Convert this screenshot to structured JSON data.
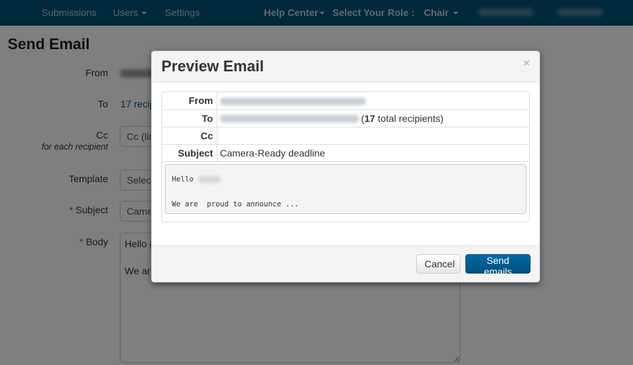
{
  "navbar": {
    "items": [
      {
        "label": "Submissions"
      },
      {
        "label": "Users",
        "dropdown": true
      },
      {
        "label": "Settings"
      }
    ],
    "help_center": "Help Center",
    "role_label": "Select Your Role :",
    "role_value": "Chair"
  },
  "page": {
    "title": "Send Email",
    "form": {
      "from_label": "From",
      "to_label": "To",
      "to_value": "17 recip",
      "cc_label": "Cc",
      "cc_sublabel": "for each recipient",
      "cc_placeholder": "Cc (lim",
      "template_label": "Template",
      "template_value": "Select",
      "subject_label": "Subject",
      "subject_value": "Camer",
      "body_label": "Body",
      "body_value": "Hello {\n\nWe are",
      "required_marker": "*"
    }
  },
  "modal": {
    "title": "Preview Email",
    "close_icon": "×",
    "fields": {
      "from_label": "From",
      "to_label": "To",
      "to_count": "17",
      "to_suffix": " total recipients)",
      "to_prefix": "(",
      "cc_label": "Cc",
      "subject_label": "Subject",
      "subject_value": "Camera-Ready deadline"
    },
    "body_greeting": "Hello",
    "body_text": "We are  proud to announce ...",
    "cancel_label": "Cancel",
    "send_label": "Send emails"
  },
  "colors": {
    "navbar": "#00527a",
    "primary_button": "#005a8e"
  }
}
